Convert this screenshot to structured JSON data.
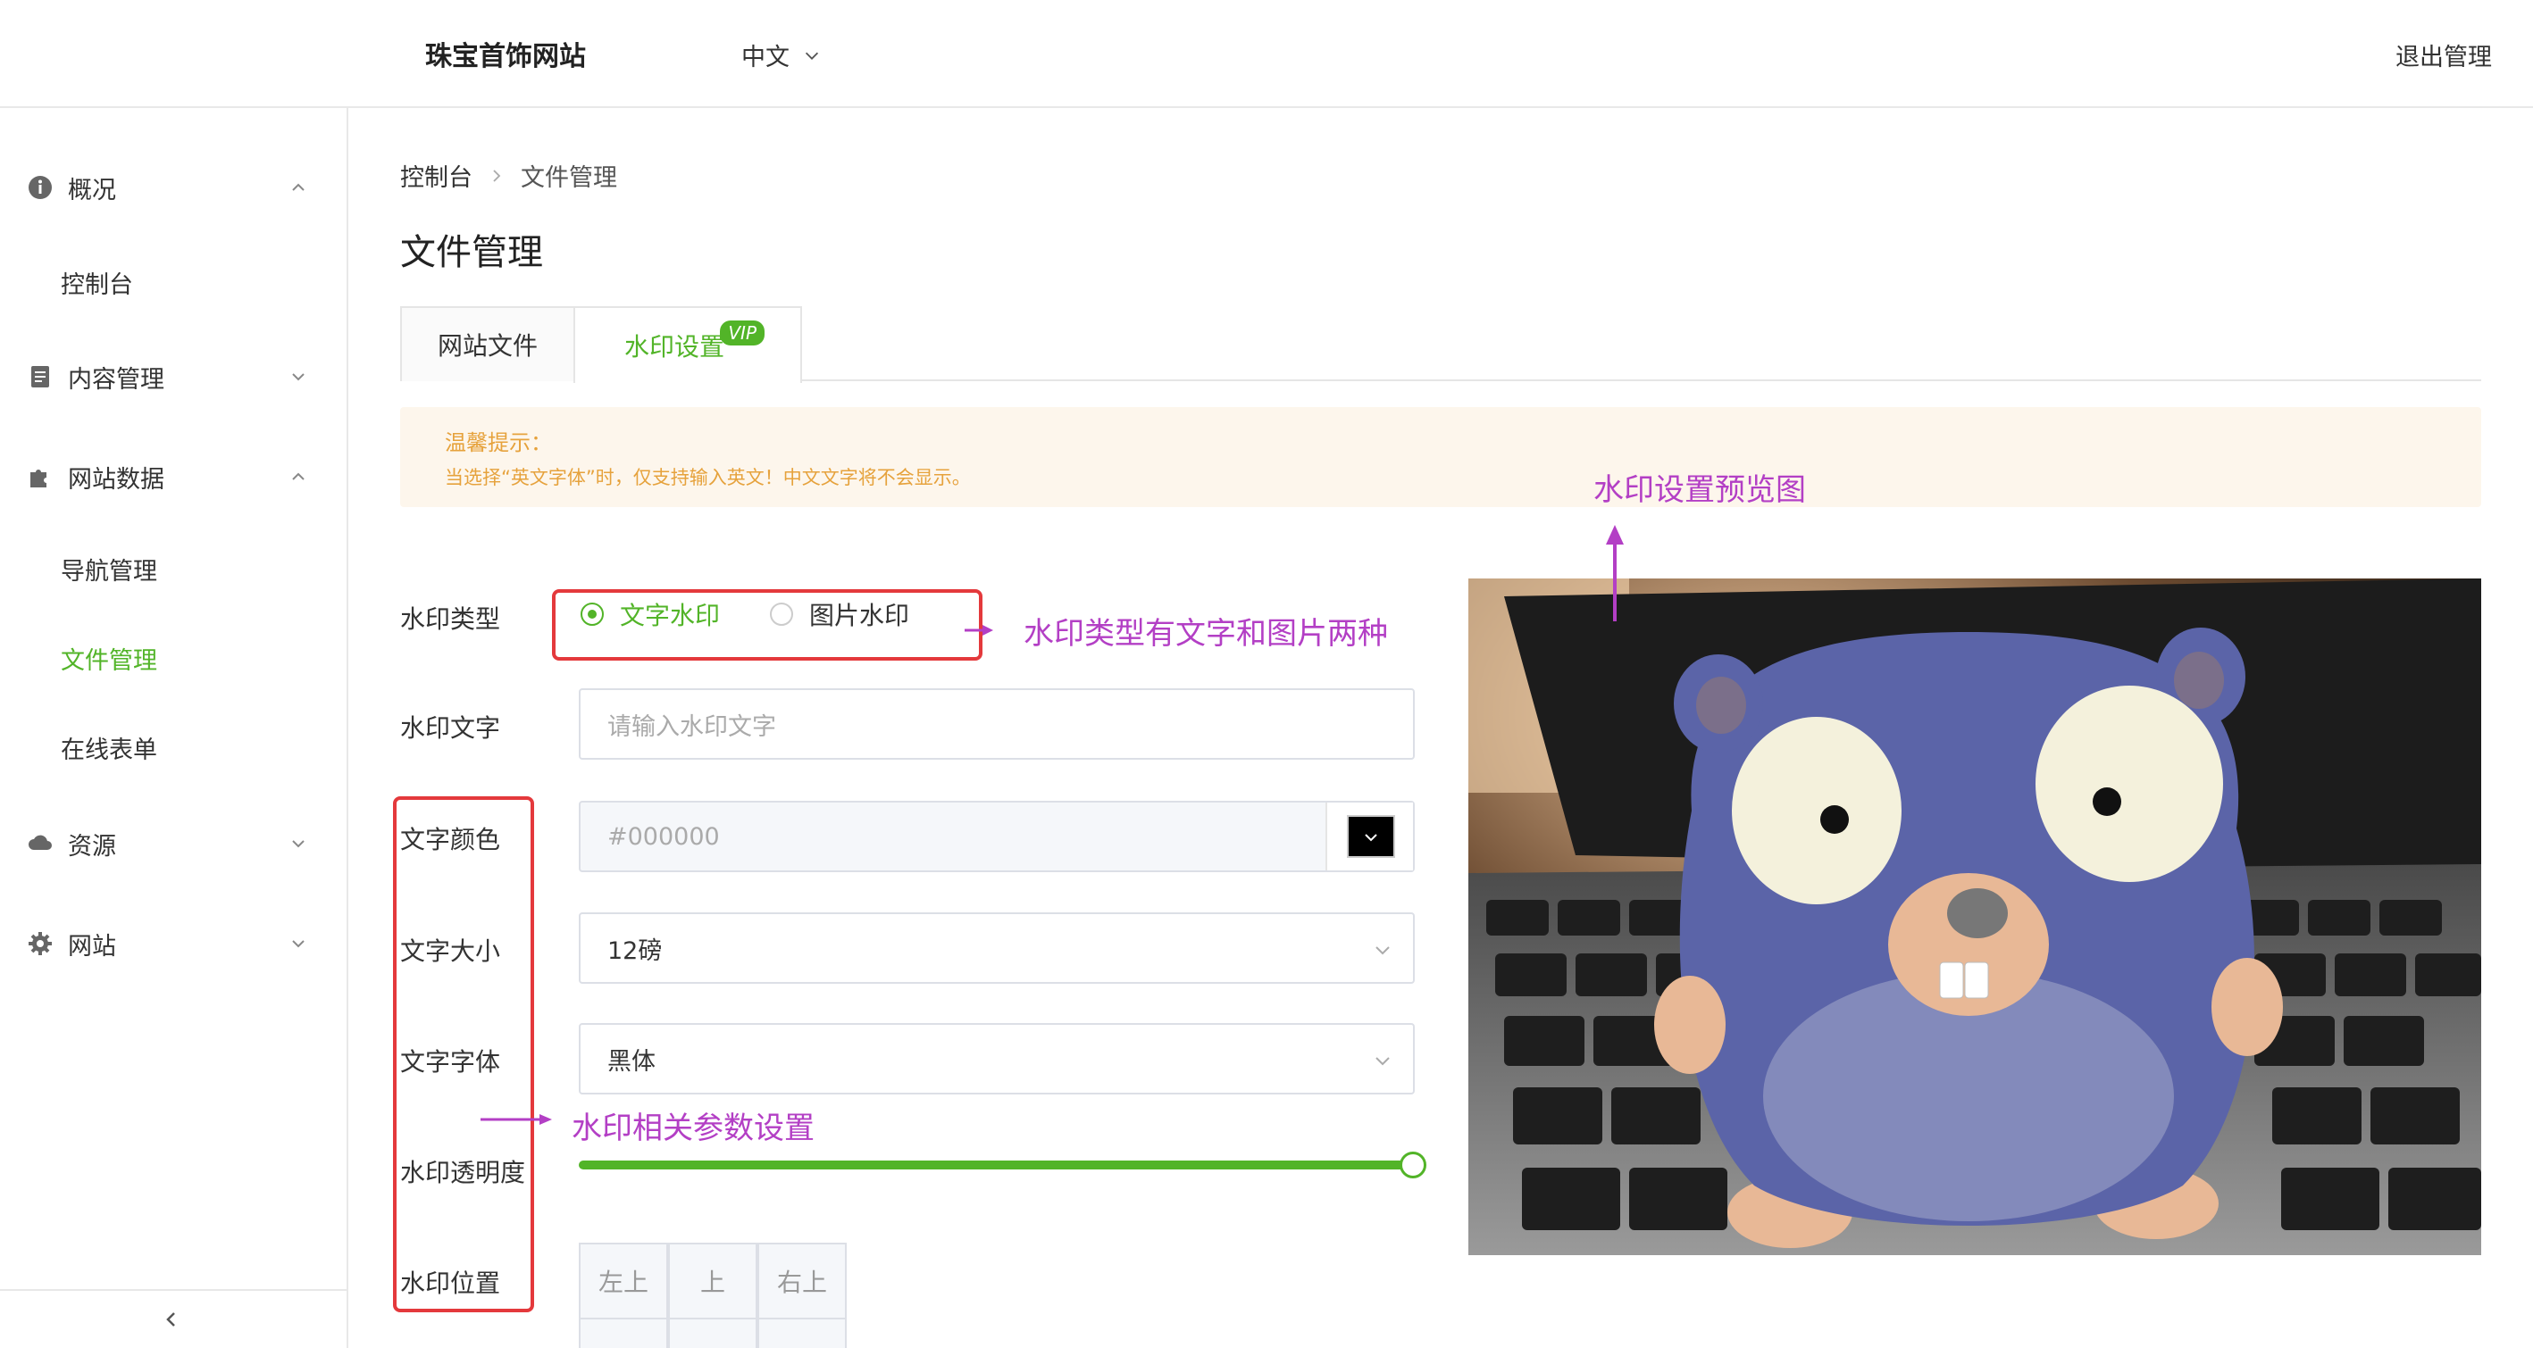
{
  "header": {
    "site_name": "珠宝首饰网站",
    "language": "中文",
    "logout": "退出管理"
  },
  "sidebar": {
    "groups": [
      {
        "label": "概况",
        "icon": "info-icon",
        "expanded": true,
        "items": [
          "控制台"
        ]
      },
      {
        "label": "内容管理",
        "icon": "document-icon",
        "expanded": false,
        "items": []
      },
      {
        "label": "网站数据",
        "icon": "puzzle-icon",
        "expanded": true,
        "items": [
          "导航管理",
          "文件管理",
          "在线表单"
        ]
      },
      {
        "label": "资源",
        "icon": "cloud-icon",
        "expanded": false,
        "items": []
      },
      {
        "label": "网站",
        "icon": "gear-icon",
        "expanded": false,
        "items": []
      }
    ],
    "active_item": "文件管理"
  },
  "breadcrumb": [
    "控制台",
    "文件管理"
  ],
  "page_title": "文件管理",
  "tabs": [
    {
      "label": "网站文件",
      "active": false
    },
    {
      "label": "水印设置",
      "active": true,
      "badge": "VIP"
    }
  ],
  "notice": {
    "title": "温馨提示：",
    "text": "当选择“英文字体”时，仅支持输入英文！中文文字将不会显示。"
  },
  "form": {
    "watermark_type": {
      "label": "水印类型",
      "options": [
        "文字水印",
        "图片水印"
      ],
      "selected": "文字水印"
    },
    "watermark_text": {
      "label": "水印文字",
      "placeholder": "请输入水印文字",
      "value": ""
    },
    "text_color": {
      "label": "文字颜色",
      "placeholder": "#000000",
      "swatch": "#000000"
    },
    "text_size": {
      "label": "文字大小",
      "value": "12磅"
    },
    "text_font": {
      "label": "文字字体",
      "value": "黑体"
    },
    "opacity": {
      "label": "水印透明度",
      "value_percent": 100
    },
    "position": {
      "label": "水印位置",
      "cells": [
        "左上",
        "上",
        "右上"
      ]
    }
  },
  "annotations": {
    "preview": "水印设置预览图",
    "type": "水印类型有文字和图片两种",
    "params": "水印相关参数设置"
  },
  "colors": {
    "accent": "#52b428",
    "warning_bg": "#fdf6ec",
    "warning_text": "#e6a23c",
    "annotation": "#b33fc5",
    "highlight_box": "#e4393c"
  }
}
